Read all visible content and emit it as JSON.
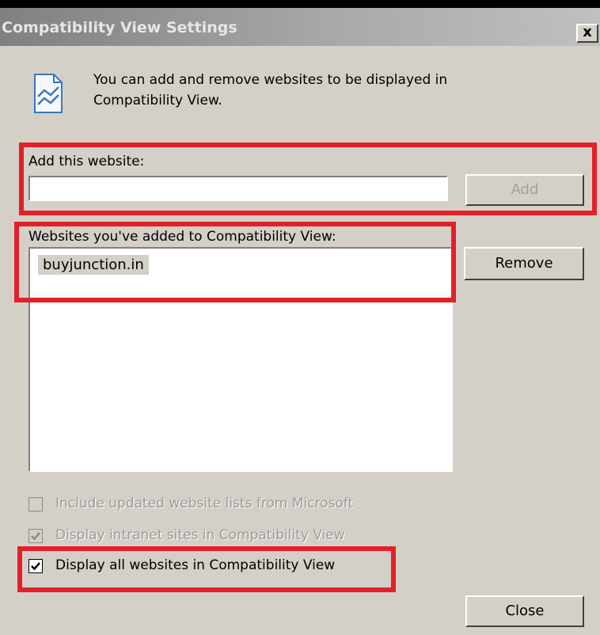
{
  "window": {
    "title": "Compatibility View Settings",
    "close_glyph": "x"
  },
  "intro": {
    "icon": "compatibility-view-icon",
    "text": "You can add and remove websites to be displayed in Compatibility View."
  },
  "add_section": {
    "label": "Add this website:",
    "input_value": "",
    "add_button": "Add"
  },
  "list_section": {
    "label": "Websites you've added to Compatibility View:",
    "items": [
      "buyjunction.in"
    ],
    "remove_button": "Remove"
  },
  "options": [
    {
      "label": "Include updated website lists from Microsoft",
      "checked": false,
      "enabled": false
    },
    {
      "label": "Display intranet sites in Compatibility View",
      "checked": true,
      "enabled": false
    },
    {
      "label": "Display all websites in Compatibility View",
      "checked": true,
      "enabled": true
    }
  ],
  "footer": {
    "close_button": "Close"
  },
  "colors": {
    "dialog_bg": "#d4d0c8",
    "highlight": "#e3202a"
  }
}
